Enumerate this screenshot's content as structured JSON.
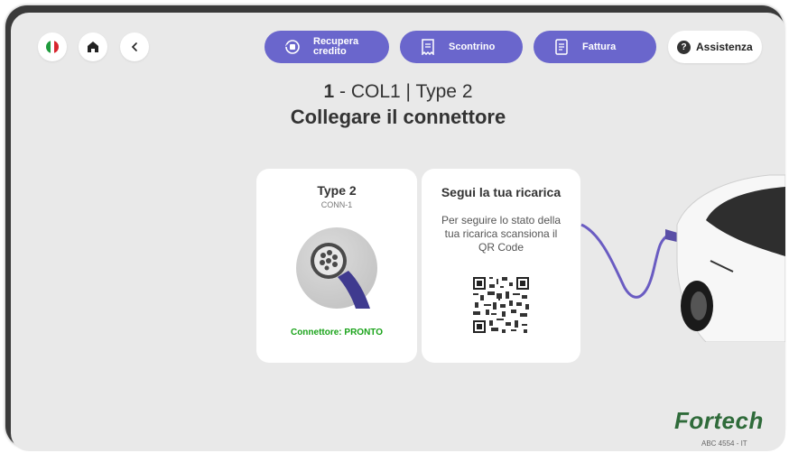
{
  "top_nav": {
    "language_flag": "it-flag-icon",
    "home_icon": "home-icon",
    "back_icon": "chevron-left-icon"
  },
  "actions": {
    "recupera_label_line1": "Recupera",
    "recupera_label_line2": "credito",
    "scontrino_label": "Scontrino",
    "fattura_label": "Fattura",
    "assistenza_label": "Assistenza",
    "assistenza_icon_text": "?"
  },
  "header": {
    "number": "1",
    "station": " - COL1 | Type 2",
    "instruction": "Collegare il connettore"
  },
  "connector_card": {
    "title": "Type 2",
    "code": "CONN-1",
    "status": "Connettore: PRONTO"
  },
  "tracking_card": {
    "title": "Segui la tua ricarica",
    "text": "Per seguire lo stato della tua ricarica scansiona il QR Code"
  },
  "footer": {
    "brand": "Fortech",
    "serial": "ABC 4554 - IT"
  },
  "colors": {
    "accent": "#6a66cc",
    "status_ok": "#1aa31a",
    "brand": "#2f6b3a",
    "background": "#e9e9e9"
  }
}
